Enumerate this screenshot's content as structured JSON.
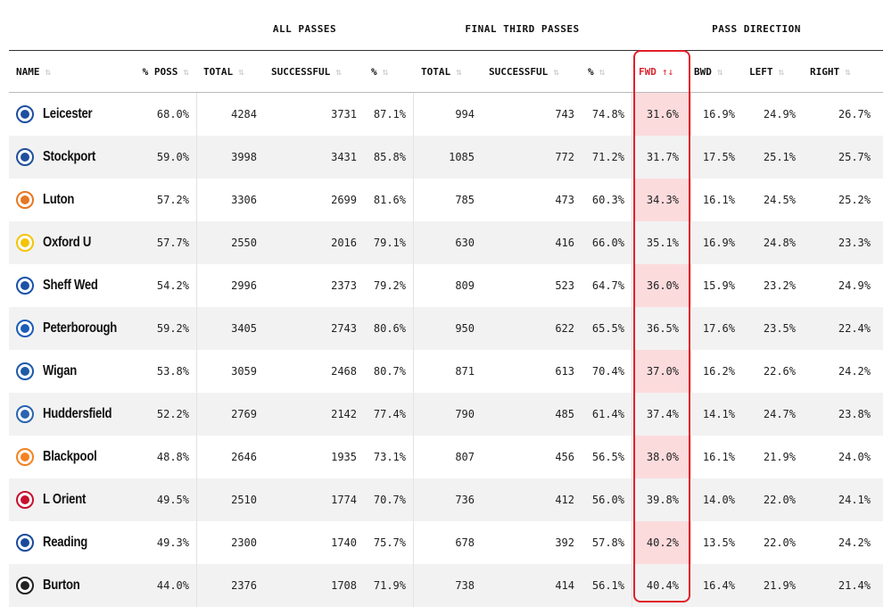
{
  "group_headers": {
    "all_passes": "ALL PASSES",
    "final_third_passes": "FINAL THIRD PASSES",
    "pass_direction": "PASS DIRECTION"
  },
  "columns": {
    "name": "NAME",
    "poss": "% POSS",
    "all_total": "TOTAL",
    "all_successful": "SUCCESSFUL",
    "all_pct": "%",
    "ft_total": "TOTAL",
    "ft_successful": "SUCCESSFUL",
    "ft_pct": "%",
    "fwd": "FWD",
    "bwd": "BWD",
    "left": "LEFT",
    "right": "RIGHT"
  },
  "sort_icons": {
    "default": "⇅",
    "active": "↑↓"
  },
  "colors": {
    "accent": "#e0202a",
    "row_alt": "#f2f2f2"
  },
  "rows": [
    {
      "name": "Leicester",
      "crest": "leicester-crest-icon",
      "crest_color": "#1d4fa0",
      "poss": "68.0%",
      "all_total": "4284",
      "all_successful": "3731",
      "all_pct": "87.1%",
      "ft_total": "994",
      "ft_successful": "743",
      "ft_pct": "74.8%",
      "fwd": "31.6%",
      "bwd": "16.9%",
      "left": "24.9%",
      "right": "26.7%"
    },
    {
      "name": "Stockport",
      "crest": "stockport-crest-icon",
      "crest_color": "#1f4f9e",
      "poss": "59.0%",
      "all_total": "3998",
      "all_successful": "3431",
      "all_pct": "85.8%",
      "ft_total": "1085",
      "ft_successful": "772",
      "ft_pct": "71.2%",
      "fwd": "31.7%",
      "bwd": "17.5%",
      "left": "25.1%",
      "right": "25.7%"
    },
    {
      "name": "Luton",
      "crest": "luton-crest-icon",
      "crest_color": "#e87722",
      "poss": "57.2%",
      "all_total": "3306",
      "all_successful": "2699",
      "all_pct": "81.6%",
      "ft_total": "785",
      "ft_successful": "473",
      "ft_pct": "60.3%",
      "fwd": "34.3%",
      "bwd": "16.1%",
      "left": "24.5%",
      "right": "25.2%"
    },
    {
      "name": "Oxford U",
      "crest": "oxford-crest-icon",
      "crest_color": "#f4c400",
      "poss": "57.7%",
      "all_total": "2550",
      "all_successful": "2016",
      "all_pct": "79.1%",
      "ft_total": "630",
      "ft_successful": "416",
      "ft_pct": "66.0%",
      "fwd": "35.1%",
      "bwd": "16.9%",
      "left": "24.8%",
      "right": "23.3%"
    },
    {
      "name": "Sheff Wed",
      "crest": "sheff-wed-crest-icon",
      "crest_color": "#1a52a8",
      "poss": "54.2%",
      "all_total": "2996",
      "all_successful": "2373",
      "all_pct": "79.2%",
      "ft_total": "809",
      "ft_successful": "523",
      "ft_pct": "64.7%",
      "fwd": "36.0%",
      "bwd": "15.9%",
      "left": "23.2%",
      "right": "24.9%"
    },
    {
      "name": "Peterborough",
      "crest": "peterborough-crest-icon",
      "crest_color": "#1d5cb8",
      "poss": "59.2%",
      "all_total": "3405",
      "all_successful": "2743",
      "all_pct": "80.6%",
      "ft_total": "950",
      "ft_successful": "622",
      "ft_pct": "65.5%",
      "fwd": "36.5%",
      "bwd": "17.6%",
      "left": "23.5%",
      "right": "22.4%"
    },
    {
      "name": "Wigan",
      "crest": "wigan-crest-icon",
      "crest_color": "#1e5aa8",
      "poss": "53.8%",
      "all_total": "3059",
      "all_successful": "2468",
      "all_pct": "80.7%",
      "ft_total": "871",
      "ft_successful": "613",
      "ft_pct": "70.4%",
      "fwd": "37.0%",
      "bwd": "16.2%",
      "left": "22.6%",
      "right": "24.2%"
    },
    {
      "name": "Huddersfield",
      "crest": "huddersfield-crest-icon",
      "crest_color": "#2a64b0",
      "poss": "52.2%",
      "all_total": "2769",
      "all_successful": "2142",
      "all_pct": "77.4%",
      "ft_total": "790",
      "ft_successful": "485",
      "ft_pct": "61.4%",
      "fwd": "37.4%",
      "bwd": "14.1%",
      "left": "24.7%",
      "right": "23.8%"
    },
    {
      "name": "Blackpool",
      "crest": "blackpool-crest-icon",
      "crest_color": "#f58220",
      "poss": "48.8%",
      "all_total": "2646",
      "all_successful": "1935",
      "all_pct": "73.1%",
      "ft_total": "807",
      "ft_successful": "456",
      "ft_pct": "56.5%",
      "fwd": "38.0%",
      "bwd": "16.1%",
      "left": "21.9%",
      "right": "24.0%"
    },
    {
      "name": "L Orient",
      "crest": "leyton-orient-crest-icon",
      "crest_color": "#c8102e",
      "poss": "49.5%",
      "all_total": "2510",
      "all_successful": "1774",
      "all_pct": "70.7%",
      "ft_total": "736",
      "ft_successful": "412",
      "ft_pct": "56.0%",
      "fwd": "39.8%",
      "bwd": "14.0%",
      "left": "22.0%",
      "right": "24.1%"
    },
    {
      "name": "Reading",
      "crest": "reading-crest-icon",
      "crest_color": "#1a4a9c",
      "poss": "49.3%",
      "all_total": "2300",
      "all_successful": "1740",
      "all_pct": "75.7%",
      "ft_total": "678",
      "ft_successful": "392",
      "ft_pct": "57.8%",
      "fwd": "40.2%",
      "bwd": "13.5%",
      "left": "22.0%",
      "right": "24.2%"
    },
    {
      "name": "Burton",
      "crest": "burton-crest-icon",
      "crest_color": "#222222",
      "poss": "44.0%",
      "all_total": "2376",
      "all_successful": "1708",
      "all_pct": "71.9%",
      "ft_total": "738",
      "ft_successful": "414",
      "ft_pct": "56.1%",
      "fwd": "40.4%",
      "bwd": "16.4%",
      "left": "21.9%",
      "right": "21.4%"
    }
  ]
}
